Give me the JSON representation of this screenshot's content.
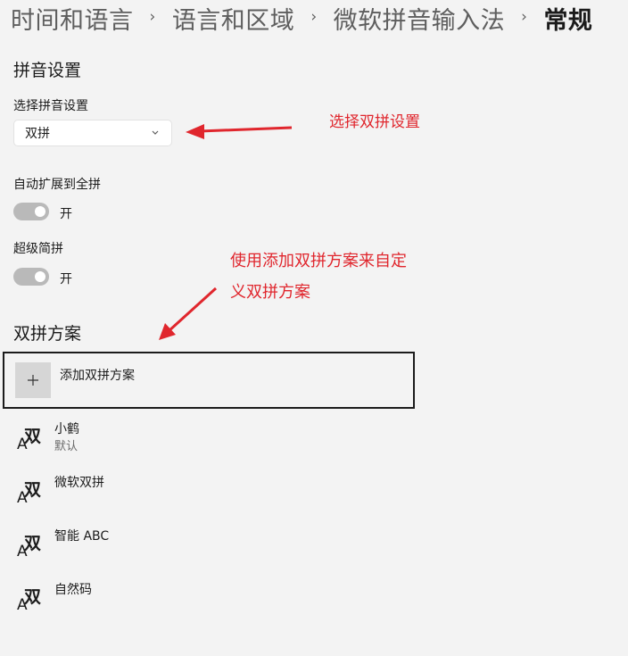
{
  "breadcrumb": {
    "items": [
      "时间和语言",
      "语言和区域",
      "微软拼音输入法"
    ],
    "current": "常规"
  },
  "pinyin_settings": {
    "section_title": "拼音设置",
    "select_label": "选择拼音设置",
    "select_value": "双拼",
    "auto_expand_label": "自动扩展到全拼",
    "auto_expand_state": "开",
    "super_abbrev_label": "超级简拼",
    "super_abbrev_state": "开"
  },
  "shuangpin": {
    "section_title": "双拼方案",
    "add_label": "添加双拼方案",
    "schemes": [
      {
        "name": "小鹤",
        "sub": "默认",
        "icon_big": "双",
        "icon_small": "A"
      },
      {
        "name": "微软双拼",
        "sub": "",
        "icon_big": "双",
        "icon_small": "A"
      },
      {
        "name": "智能 ABC",
        "sub": "",
        "icon_big": "双",
        "icon_small": "A"
      },
      {
        "name": "自然码",
        "sub": "",
        "icon_big": "双",
        "icon_small": "A"
      }
    ]
  },
  "annotations": {
    "dropdown_note": "选择双拼设置",
    "custom_note_line1": "使用添加双拼方案来自定",
    "custom_note_line2": "义双拼方案"
  },
  "colors": {
    "background": "#f3f3f3",
    "annotation": "#e0262d",
    "toggle_off": "#b9b9b9"
  }
}
